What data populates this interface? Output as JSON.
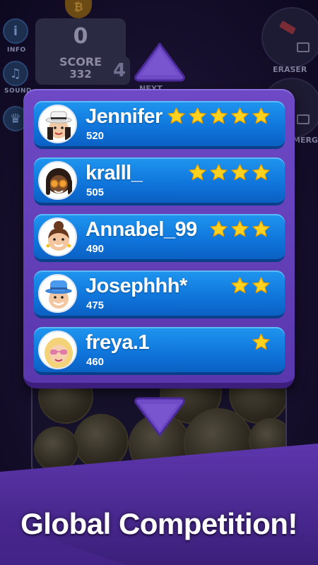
{
  "hud": {
    "info_label": "INFO",
    "sound_label": "SOUND",
    "score_value": "0",
    "score_label": "SCORE",
    "best_score": "332",
    "next_value": "4",
    "next_label": "NEXT",
    "coin_symbol": "₿",
    "eraser_label": "ERASER",
    "merge_label": "MERGE"
  },
  "leaderboard": {
    "players": [
      {
        "name": "Jennifer",
        "score": "520",
        "stars": 5,
        "avatar": "woman-with-hat-avatar"
      },
      {
        "name": "kralll_",
        "score": "505",
        "stars": 4,
        "avatar": "man-with-dreadlocks-avatar"
      },
      {
        "name": "Annabel_99",
        "score": "490",
        "stars": 3,
        "avatar": "woman-with-bun-avatar"
      },
      {
        "name": "Josephhh*",
        "score": "475",
        "stars": 2,
        "avatar": "man-with-blue-hat-avatar"
      },
      {
        "name": "freya.1",
        "score": "460",
        "stars": 1,
        "avatar": "blonde-woman-sunglasses-avatar"
      }
    ]
  },
  "banner": {
    "tagline": "Global Competition!"
  },
  "colors": {
    "popup": "#6a45c0",
    "row": "#137fe3",
    "star": "#ffd21f",
    "banner": "#5b34a8"
  }
}
